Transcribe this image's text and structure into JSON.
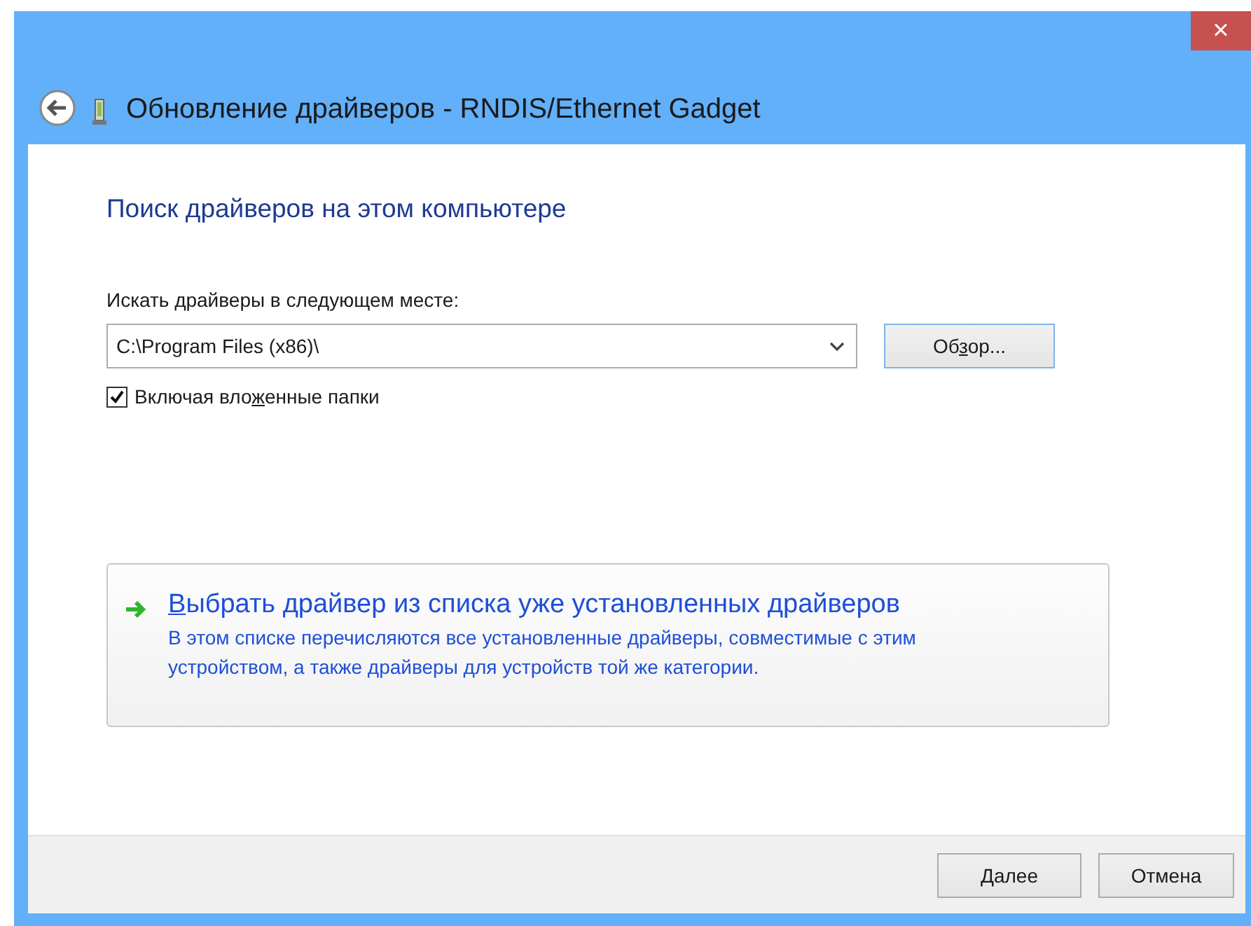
{
  "window": {
    "title": "Обновление драйверов - RNDIS/Ethernet Gadget",
    "close_glyph": "×"
  },
  "heading": "Поиск драйверов на этом компьютере",
  "location": {
    "label": "Искать драйверы в следующем месте:",
    "value": "C:\\Program Files (x86)\\",
    "browse_button": {
      "pre": "Об",
      "key": "з",
      "post": "ор..."
    }
  },
  "include_subfolders": {
    "checked": true,
    "label": {
      "pre": "Включая вло",
      "key": "ж",
      "post": "енные папки"
    }
  },
  "command_link": {
    "title": {
      "key": "В",
      "post": "ыбрать драйвер из списка уже установленных драйверов"
    },
    "description": "В этом списке перечисляются все установленные драйверы, совместимые с этим устройством, а также драйверы для устройств той же категории."
  },
  "buttons": [
    {
      "key": "Д",
      "post": "алее"
    },
    {
      "post": "Отмена"
    }
  ]
}
